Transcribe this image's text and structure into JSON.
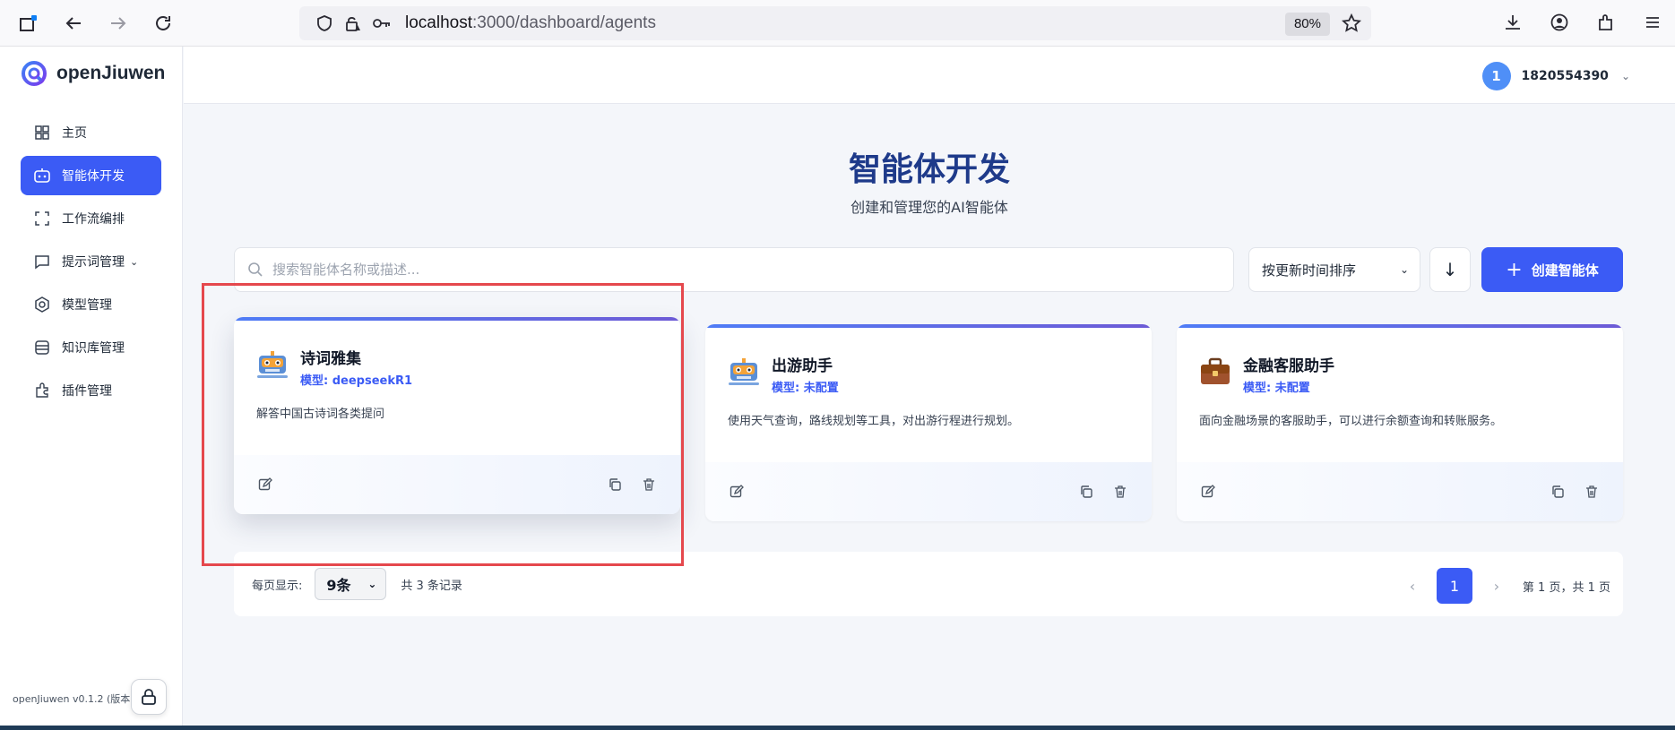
{
  "browser": {
    "url_host": "localhost",
    "url_path": ":3000/dashboard/agents",
    "zoom": "80%"
  },
  "app": {
    "logo_text": "openJiuwen",
    "version": "openJiuwen v0.1.2 (版本"
  },
  "sidebar": {
    "items": [
      {
        "label": "主页",
        "icon": "grid-icon"
      },
      {
        "label": "智能体开发",
        "icon": "robot-icon",
        "active": true
      },
      {
        "label": "工作流编排",
        "icon": "workflow-icon"
      },
      {
        "label": "提示词管理",
        "icon": "chat-icon",
        "has_caret": true
      },
      {
        "label": "模型管理",
        "icon": "model-icon"
      },
      {
        "label": "知识库管理",
        "icon": "database-icon"
      },
      {
        "label": "插件管理",
        "icon": "plugin-icon"
      }
    ]
  },
  "user": {
    "avatar_text": "1",
    "name": "1820554390"
  },
  "page": {
    "title": "智能体开发",
    "subtitle": "创建和管理您的AI智能体"
  },
  "toolbar": {
    "search_placeholder": "搜索智能体名称或描述...",
    "sort_label": "按更新时间排序",
    "sort_direction": "↓",
    "create_label": "创建智能体"
  },
  "agents": [
    {
      "name": "诗词雅集",
      "model": "模型: deepseekR1",
      "description": "解答中国古诗词各类提问",
      "icon": "robot-avatar-icon"
    },
    {
      "name": "出游助手",
      "model": "模型: 未配置",
      "description": "使用天气查询，路线规划等工具，对出游行程进行规划。",
      "icon": "robot-avatar-icon"
    },
    {
      "name": "金融客服助手",
      "model": "模型: 未配置",
      "description": "面向金融场景的客服助手，可以进行余额查询和转账服务。",
      "icon": "briefcase-icon"
    }
  ],
  "pagination": {
    "per_page_label": "每页显示:",
    "per_page_value": "9条",
    "total": "共 3 条记录",
    "current_page": "1",
    "page_info": "第 1 页，共 1 页"
  },
  "colors": {
    "accent": "#3b5bf5",
    "title": "#1e3a8a",
    "highlight_box": "#e5484d"
  }
}
